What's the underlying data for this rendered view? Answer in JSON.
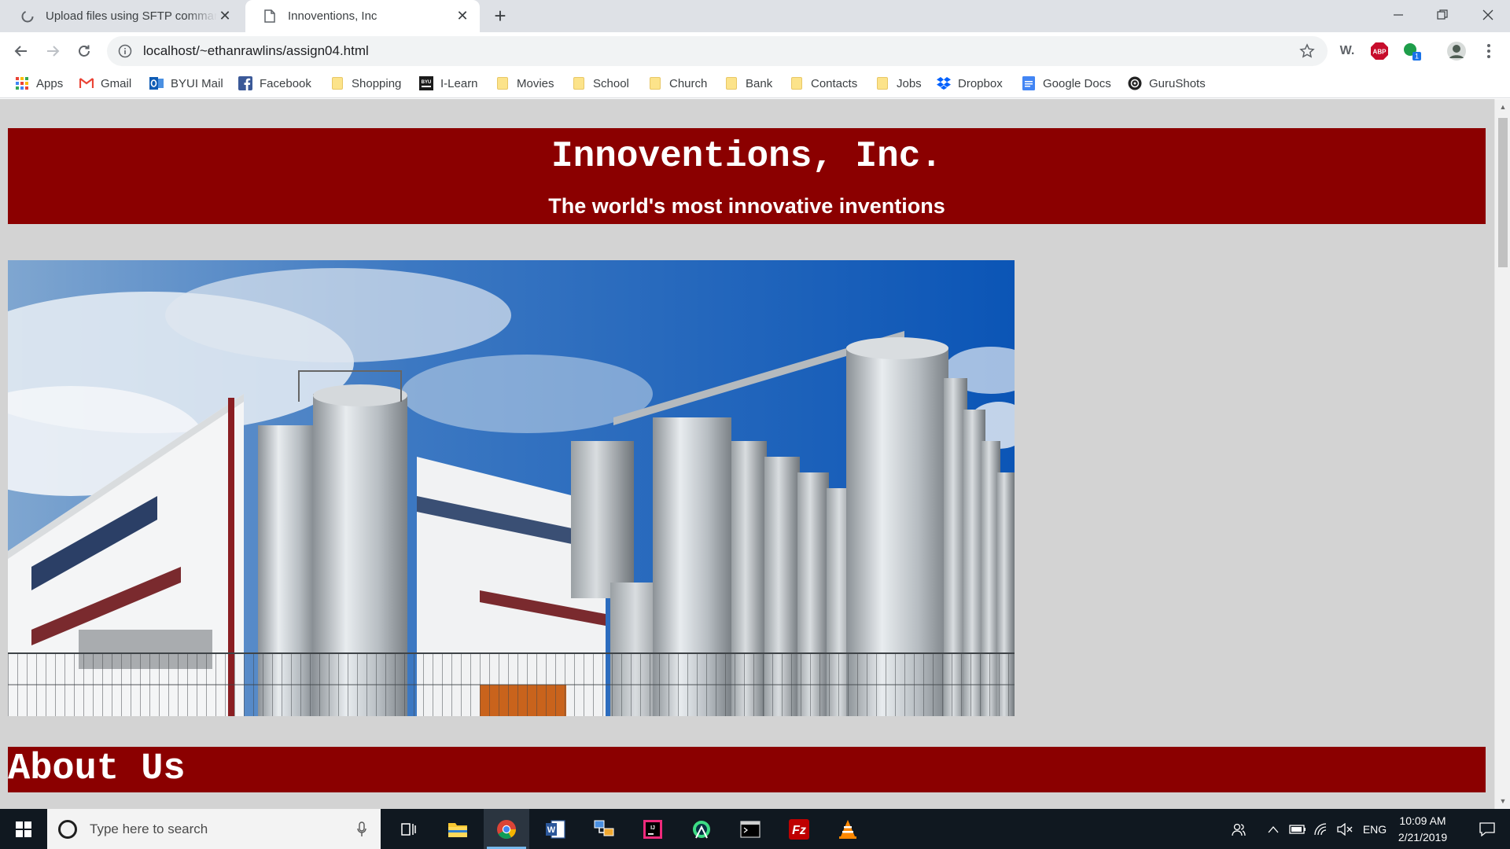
{
  "browser": {
    "tabs": [
      {
        "title": "Upload files using SFTP comman",
        "active": false,
        "favicon": "loading-spinner-icon"
      },
      {
        "title": "Innoventions, Inc",
        "active": true,
        "favicon": "page-icon"
      }
    ],
    "address": "localhost/~ethanrawlins/assign04.html",
    "extensions": [
      "word-ext-icon",
      "adblock-icon",
      "green-ext-icon",
      "profile-avatar"
    ],
    "extension_badge": "1",
    "adblock_label": "ABP",
    "word_label": "W."
  },
  "bookmarks": [
    {
      "label": "Apps",
      "icon": "apps-grid-icon"
    },
    {
      "label": "Gmail",
      "icon": "gmail-icon"
    },
    {
      "label": "BYUI Mail",
      "icon": "outlook-icon"
    },
    {
      "label": "Facebook",
      "icon": "facebook-icon"
    },
    {
      "label": "Shopping",
      "icon": "folder-icon"
    },
    {
      "label": "I-Learn",
      "icon": "byu-icon"
    },
    {
      "label": "Movies",
      "icon": "folder-icon"
    },
    {
      "label": "School",
      "icon": "folder-icon"
    },
    {
      "label": "Church",
      "icon": "folder-icon"
    },
    {
      "label": "Bank",
      "icon": "folder-icon"
    },
    {
      "label": "Contacts",
      "icon": "folder-icon"
    },
    {
      "label": "Jobs",
      "icon": "folder-icon"
    },
    {
      "label": "Dropbox",
      "icon": "dropbox-icon"
    },
    {
      "label": "Google Docs",
      "icon": "docs-icon"
    },
    {
      "label": "GuruShots",
      "icon": "gurushots-icon"
    }
  ],
  "page": {
    "title": "Innoventions, Inc.",
    "tagline": "The world's most innovative inventions",
    "hero_alt": "Industrial plant with tall steel silos",
    "section_heading": "About Us"
  },
  "taskbar": {
    "search_placeholder": "Type here to search",
    "language": "ENG",
    "time": "10:09 AM",
    "date": "2/21/2019",
    "apps": [
      "task-view-icon",
      "file-explorer-icon",
      "chrome-icon",
      "word-icon",
      "network-tool-icon",
      "intellij-icon",
      "android-studio-icon",
      "terminal-icon",
      "filezilla-icon",
      "vlc-icon"
    ]
  },
  "colors": {
    "header_bg": "#8b0000",
    "page_bg": "#d3d3d3",
    "tab_strip": "#dee1e6",
    "taskbar": "#101820"
  }
}
